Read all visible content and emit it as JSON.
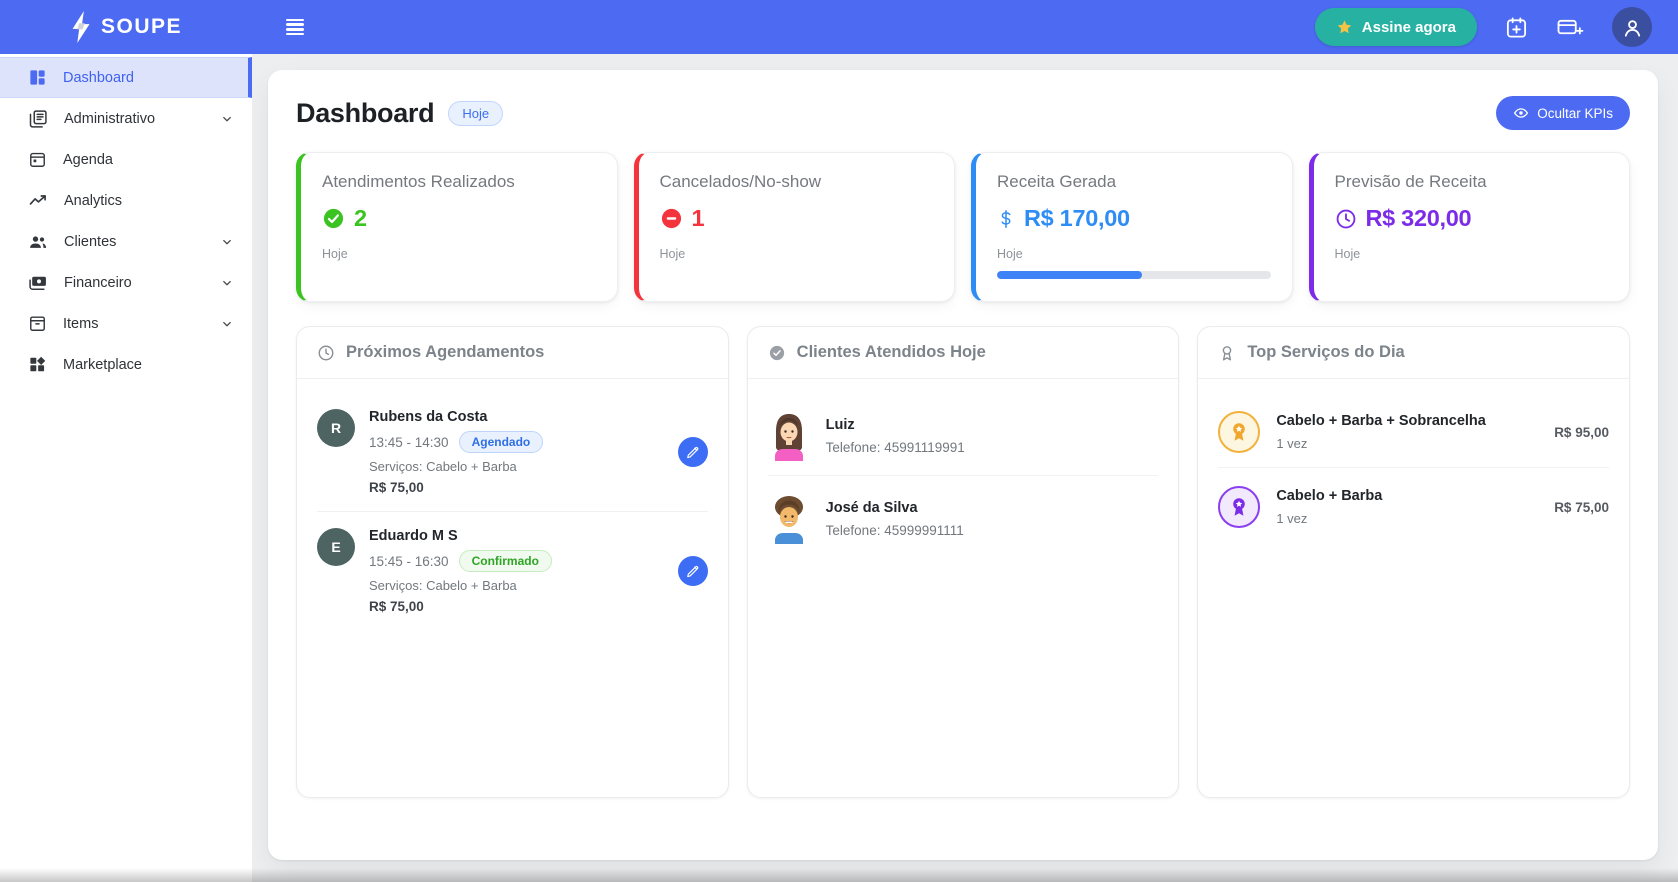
{
  "header": {
    "brand": "SOUPE",
    "subscribe_label": "Assine agora",
    "subscribe_color": "#27b1a2",
    "bar_color": "#4d6af2",
    "icons": [
      "star-icon",
      "calendar-add-icon",
      "card-add-icon",
      "user-avatar-icon"
    ]
  },
  "sidebar": {
    "items": [
      {
        "label": "Dashboard",
        "icon": "dashboard-icon",
        "active": true,
        "expandable": false
      },
      {
        "label": "Administrativo",
        "icon": "documents-icon",
        "active": false,
        "expandable": true
      },
      {
        "label": "Agenda",
        "icon": "calendar-icon",
        "active": false,
        "expandable": false
      },
      {
        "label": "Analytics",
        "icon": "trend-line-icon",
        "active": false,
        "expandable": false
      },
      {
        "label": "Clientes",
        "icon": "people-icon",
        "active": false,
        "expandable": true
      },
      {
        "label": "Financeiro",
        "icon": "money-icon",
        "active": false,
        "expandable": true
      },
      {
        "label": "Items",
        "icon": "box-icon",
        "active": false,
        "expandable": true
      },
      {
        "label": "Marketplace",
        "icon": "widgets-icon",
        "active": false,
        "expandable": false
      }
    ]
  },
  "page": {
    "title": "Dashboard",
    "badge": "Hoje",
    "hide_kpis_label": "Ocultar KPIs"
  },
  "kpis": [
    {
      "title": "Atendimentos Realizados",
      "value": "2",
      "period": "Hoje",
      "color": "#3bc421",
      "icon": "check-circle-icon"
    },
    {
      "title": "Cancelados/No-show",
      "value": "1",
      "period": "Hoje",
      "color": "#f4343c",
      "icon": "minus-circle-icon"
    },
    {
      "title": "Receita Gerada",
      "value": "R$ 170,00",
      "period": "Hoje",
      "color": "#2e8df5",
      "icon": "dollar-icon",
      "progress_percent": 53
    },
    {
      "title": "Previsão de Receita",
      "value": "R$ 320,00",
      "period": "Hoje",
      "color": "#7c2ce8",
      "icon": "clock-icon"
    }
  ],
  "appointments": {
    "title": "Próximos Agendamentos",
    "icon": "clock-icon",
    "items": [
      {
        "initial": "R",
        "name": "Rubens da Costa",
        "time": "13:45 - 14:30",
        "status": "Agendado",
        "status_color": "#2f6fe4",
        "services": "Serviços: Cabelo + Barba",
        "price": "R$ 75,00"
      },
      {
        "initial": "E",
        "name": "Eduardo M S",
        "time": "15:45 - 16:30",
        "status": "Confirmado",
        "status_color": "#2ea525",
        "services": "Serviços: Cabelo + Barba",
        "price": "R$ 75,00"
      }
    ]
  },
  "clients": {
    "title": "Clientes Atendidos Hoje",
    "icon": "check-circle-icon",
    "items": [
      {
        "name": "Luiz",
        "phone": "Telefone: 45991119991"
      },
      {
        "name": "José da Silva",
        "phone": "Telefone: 45999991111"
      }
    ]
  },
  "top_services": {
    "title": "Top Serviços do Dia",
    "icon": "medal-icon",
    "items": [
      {
        "name": "Cabelo + Barba + Sobrancelha",
        "count": "1 vez",
        "price": "R$ 95,00",
        "medal_color": "#f0a72e"
      },
      {
        "name": "Cabelo + Barba",
        "count": "1 vez",
        "price": "R$ 75,00",
        "medal_color": "#7c2ce8"
      }
    ]
  }
}
